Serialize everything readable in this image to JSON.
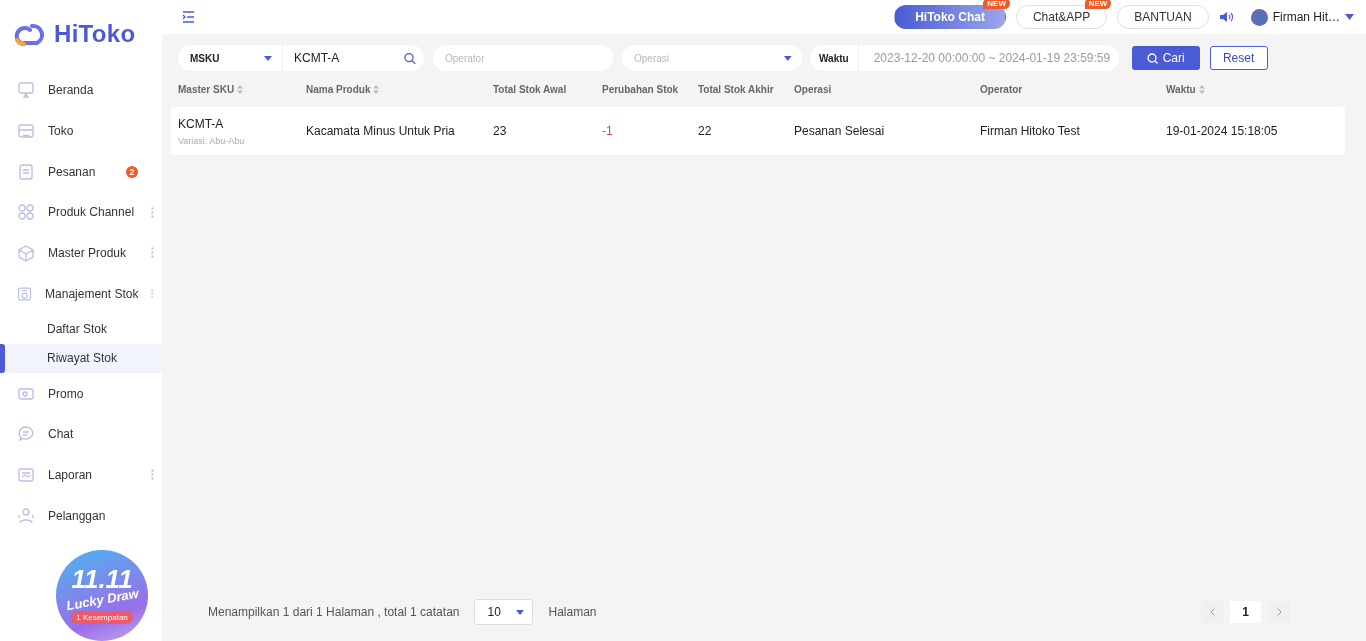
{
  "logo": {
    "text": "HiToko"
  },
  "sidebar": {
    "items": [
      {
        "label": "Beranda",
        "selected": false
      },
      {
        "label": "Toko",
        "selected": false
      },
      {
        "label": "Pesanan",
        "selected": false,
        "badge": "2"
      },
      {
        "label": "Produk Channel",
        "selected": false,
        "has_menu": true
      },
      {
        "label": "Master Produk",
        "selected": false,
        "has_menu": true
      },
      {
        "label": "Manajement Stok",
        "selected": false,
        "has_menu": true,
        "children": [
          {
            "label": "Daftar Stok",
            "selected": false
          },
          {
            "label": "Riwayat Stok",
            "selected": true
          }
        ]
      },
      {
        "label": "Promo",
        "selected": false
      },
      {
        "label": "Chat",
        "selected": false
      },
      {
        "label": "Laporan",
        "selected": false,
        "has_menu": true
      },
      {
        "label": "Pelanggan",
        "selected": false
      }
    ]
  },
  "promo": {
    "title": "11.11",
    "subtitle": "Lucky Draw",
    "badge": "1 Kesempatan"
  },
  "topbar": {
    "buttons": [
      {
        "label": "HiToko Chat",
        "kind": "primary",
        "badge": "NEW"
      },
      {
        "label": "Chat&APP",
        "kind": "outline",
        "badge": "NEW"
      },
      {
        "label": "BANTUAN",
        "kind": "outline"
      }
    ],
    "user": {
      "name": "Firman Hit…"
    }
  },
  "filters": {
    "sku_type": {
      "value": "MSKU"
    },
    "sku_search": {
      "value": "KCMT-A"
    },
    "operator": {
      "placeholder": "Operator"
    },
    "operasi": {
      "placeholder": "Operasi"
    },
    "waktu": {
      "label": "Waktu",
      "value": "2023-12-20 00:00:00  ~ 2024-01-19 23:59:59"
    },
    "search_button": "Cari",
    "reset_button": "Reset"
  },
  "table": {
    "columns": [
      {
        "label": "Master SKU",
        "sortable": true
      },
      {
        "label": "Nama Produk",
        "sortable": true
      },
      {
        "label": "Total Stok Awal",
        "sortable": false
      },
      {
        "label": "Perubahan Stok",
        "sortable": false
      },
      {
        "label": "Total Stok Akhir",
        "sortable": false
      },
      {
        "label": "Operasi",
        "sortable": false
      },
      {
        "label": "Operator",
        "sortable": false
      },
      {
        "label": "Waktu",
        "sortable": true
      }
    ],
    "rows": [
      {
        "sku": "KCMT-A",
        "variation": "Variasi: Abu-Abu",
        "product": "Kacamata Minus Untuk Pria",
        "start": "23",
        "change": "-1",
        "end": "22",
        "operation": "Pesanan Selesai",
        "operator": "Firman Hitoko Test",
        "time": "19-01-2024 15:18:05"
      }
    ]
  },
  "pagination": {
    "summary": "Menampilkan 1 dari 1 Halaman , total 1 catatan",
    "page_size": "10",
    "suffix": "Halaman",
    "pages": [
      {
        "label": "1",
        "selected": true
      }
    ]
  }
}
